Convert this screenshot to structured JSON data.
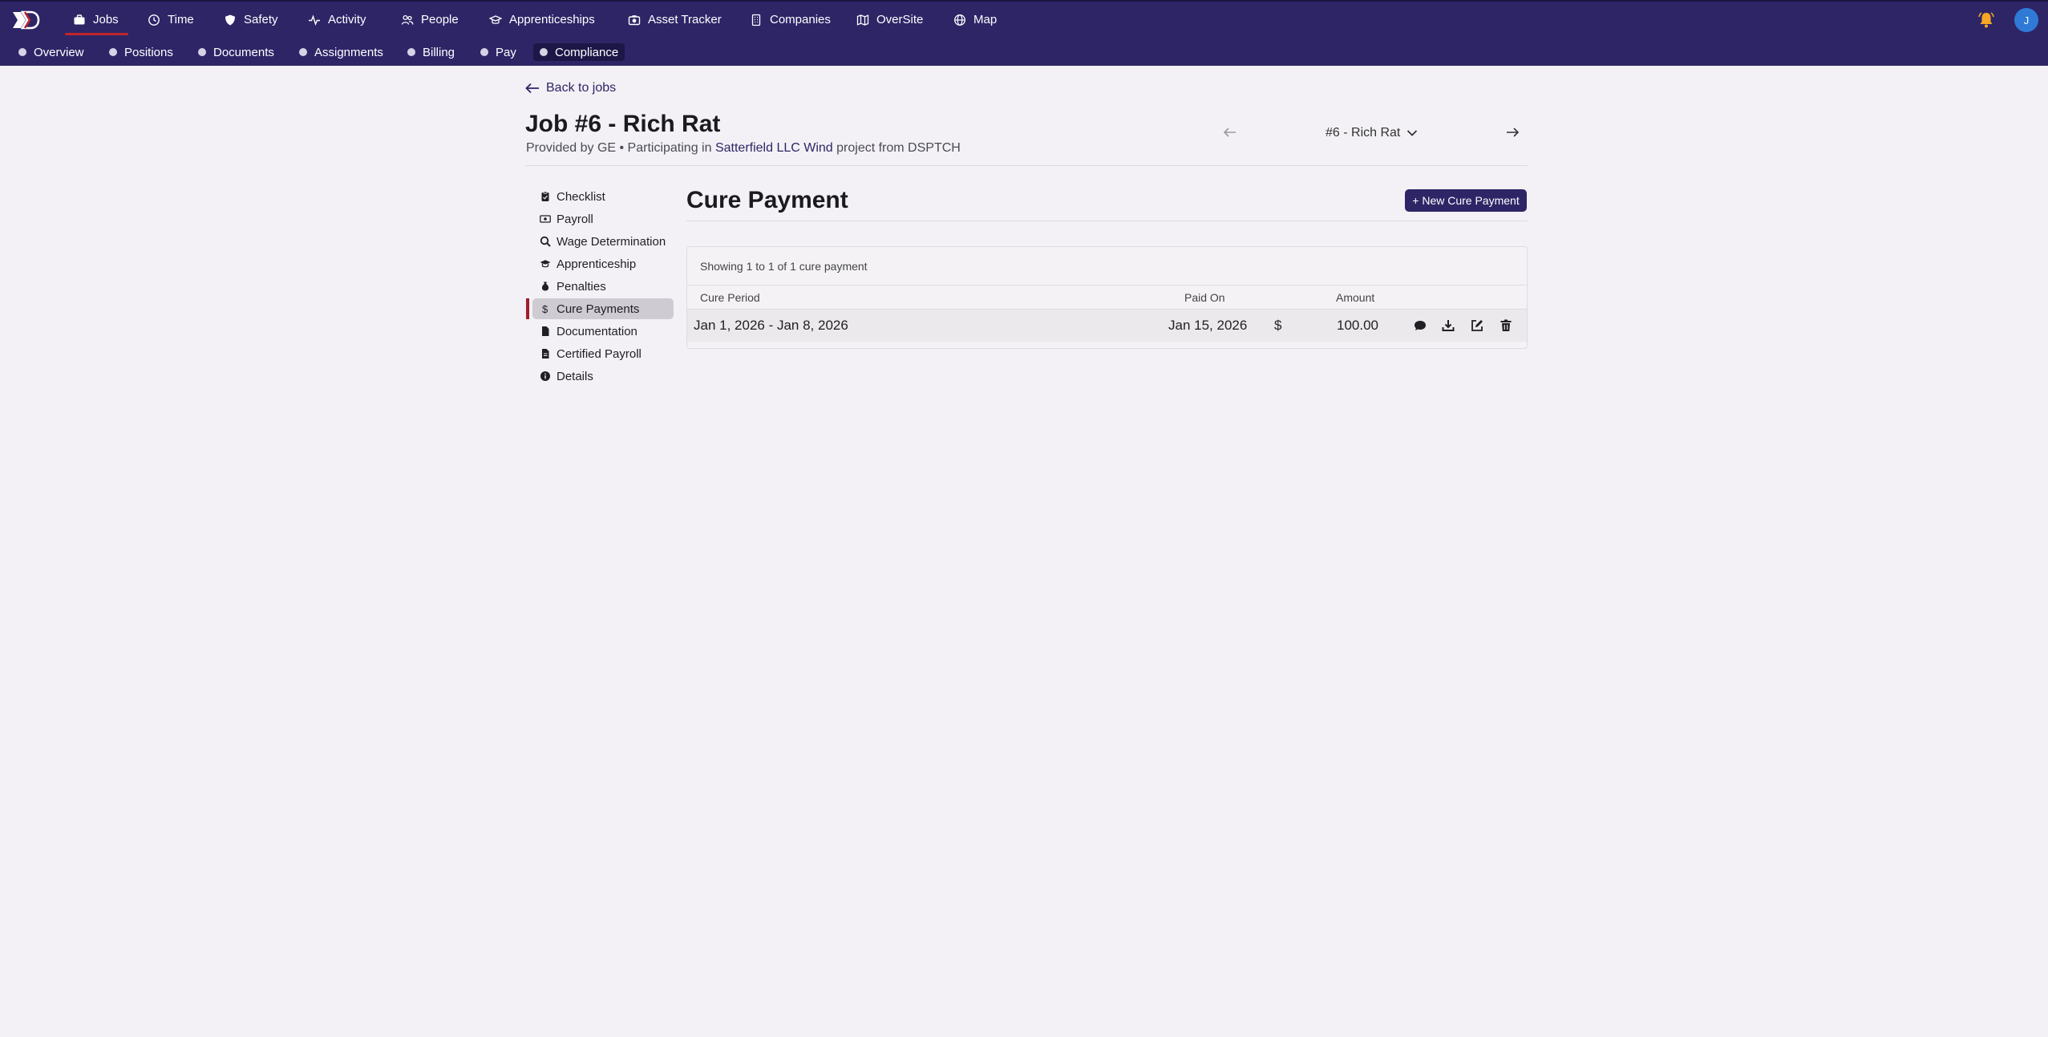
{
  "nav": {
    "items": [
      {
        "label": "Jobs",
        "icon": "briefcase-icon"
      },
      {
        "label": "Time",
        "icon": "clock-icon"
      },
      {
        "label": "Safety",
        "icon": "shield-icon"
      },
      {
        "label": "Activity",
        "icon": "activity-icon"
      },
      {
        "label": "People",
        "icon": "people-icon"
      },
      {
        "label": "Apprenticeships",
        "icon": "graduation-cap-icon"
      },
      {
        "label": "Asset Tracker",
        "icon": "camera-icon"
      },
      {
        "label": "Companies",
        "icon": "building-icon"
      },
      {
        "label": "OverSite",
        "icon": "map-icon"
      },
      {
        "label": "Map",
        "icon": "globe-icon"
      }
    ],
    "avatar_initial": "J"
  },
  "subnav": {
    "items": [
      {
        "label": "Overview"
      },
      {
        "label": "Positions"
      },
      {
        "label": "Documents"
      },
      {
        "label": "Assignments"
      },
      {
        "label": "Billing"
      },
      {
        "label": "Pay"
      },
      {
        "label": "Compliance"
      }
    ]
  },
  "header": {
    "back_label": "Back to jobs",
    "title": "Job #6 - Rich Rat",
    "subtitle_prefix": "Provided by GE • Participating in",
    "subtitle_link": "Satterfield LLC Wind",
    "subtitle_suffix": "project from DSPTCH",
    "selector_label": "#6 - Rich Rat"
  },
  "sidebar": {
    "items": [
      {
        "label": "Checklist",
        "icon": "clipboard-icon"
      },
      {
        "label": "Payroll",
        "icon": "money-icon"
      },
      {
        "label": "Wage Determination",
        "icon": "magnify-icon"
      },
      {
        "label": "Apprenticeship",
        "icon": "graduation-cap-icon"
      },
      {
        "label": "Penalties",
        "icon": "money-bag-icon"
      },
      {
        "label": "Cure Payments",
        "icon": "dollar-icon"
      },
      {
        "label": "Documentation",
        "icon": "file-icon"
      },
      {
        "label": "Certified Payroll",
        "icon": "file-lines-icon"
      },
      {
        "label": "Details",
        "icon": "info-icon"
      }
    ]
  },
  "main": {
    "title": "Cure Payment",
    "new_button": "+ New Cure Payment",
    "showing": "Showing 1 to 1 of 1 cure payment",
    "columns": {
      "period": "Cure Period",
      "paid_on": "Paid On",
      "amount": "Amount"
    },
    "rows": [
      {
        "period": "Jan 1, 2026 - Jan 8, 2026",
        "paid_on": "Jan 15, 2026",
        "currency": "$",
        "amount": "100.00"
      }
    ]
  },
  "colors": {
    "brand": "#2e2567",
    "accent": "#c0262b",
    "notification": "#f5a623"
  }
}
